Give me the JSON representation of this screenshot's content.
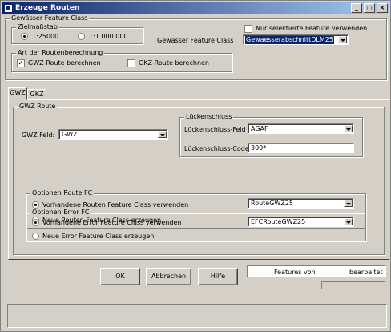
{
  "window": {
    "title": "Erzeuge Routen",
    "minimize": "_",
    "maximize": "□",
    "close": "×"
  },
  "top": {
    "group_title": "Gewässer Feature Class",
    "zielmassstab": {
      "label": "Zielmaßstab",
      "options": [
        "1:25000",
        "1:1.000.000"
      ],
      "selected": "1:25000"
    },
    "nur_selektierte": "Nur selektierte Feature verwenden",
    "fc_label": "Gewässer Feature Class",
    "fc_value": "GewaesserabschnittDLM25",
    "routen": {
      "label": "Art der Routenberechnung",
      "gwz": "GWZ-Route berechnen",
      "gwz_checked": true,
      "gkz": "GKZ-Route berechnen",
      "gkz_checked": false
    }
  },
  "tabs": [
    "GWZ",
    "GKZ"
  ],
  "gwz": {
    "group_title": "GWZ Route",
    "feld_label": "GWZ Feld:",
    "feld_value": "GWZ",
    "lueckenschluss": {
      "title": "Lückenschluss",
      "feld_label": "Lückenschluss-Feld",
      "feld_value": "AGAF",
      "code_label": "Lückenschluss-Code",
      "code_value": "300*"
    },
    "route_fc": {
      "title": "Optionen Route FC",
      "existing": "Vorhandene Routen Feature Class verwenden",
      "existing_value": "RouteGWZ25",
      "new": "Neue Routen Feature Class erzeugen"
    },
    "error_fc": {
      "title": "Optionen Error FC",
      "existing": "Vorhandene Error Feature Class verwenden",
      "existing_value": "EFCRouteGWZ25",
      "new": "Neue Error Feature Class erzeugen"
    }
  },
  "buttons": {
    "ok": "OK",
    "abbrechen": "Abbrechen",
    "hilfe": "Hilfe"
  },
  "progress": {
    "features_von": "Features von",
    "bearbeitet": "bearbeitet"
  },
  "icons": {
    "title": "app-window-icon",
    "combo_arrow": "chevron-down-icon"
  }
}
